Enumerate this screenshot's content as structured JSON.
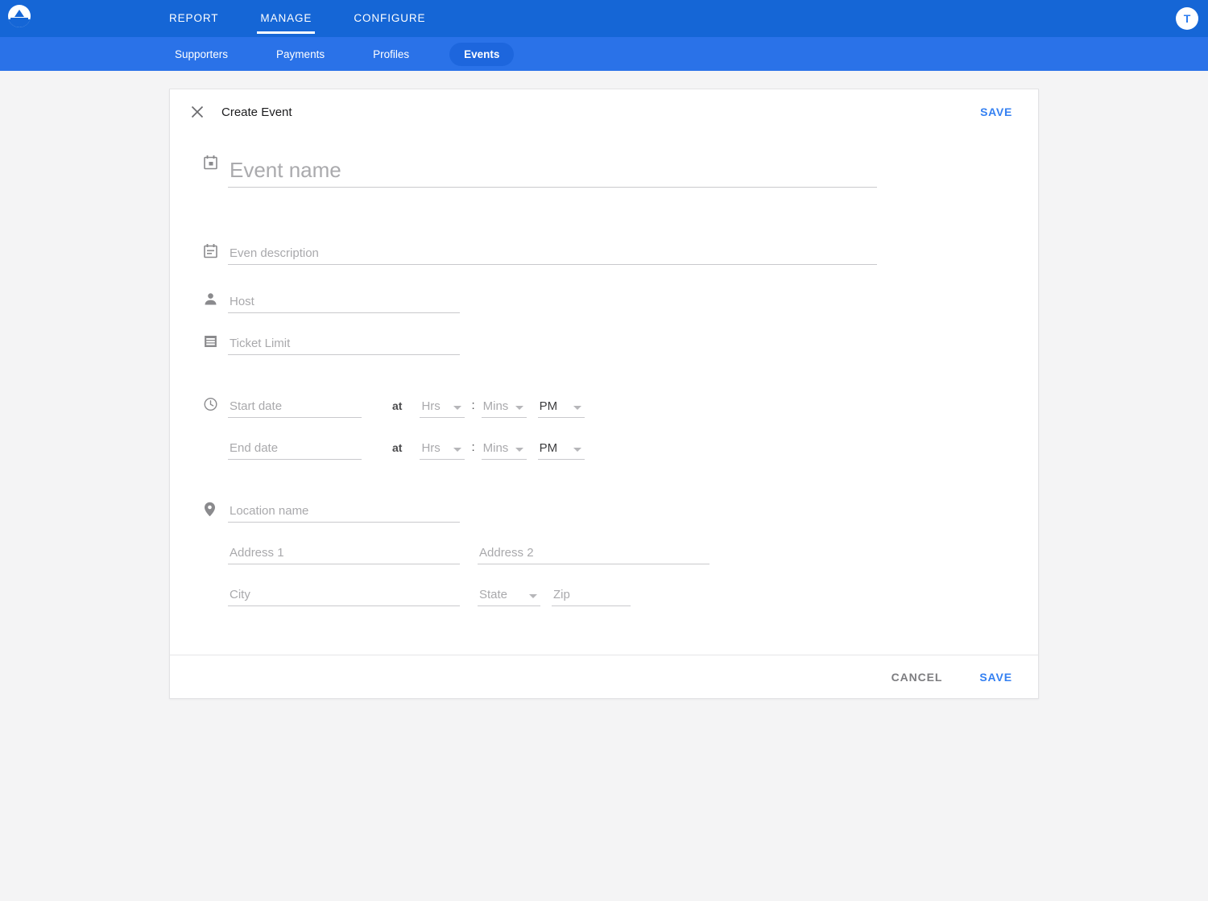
{
  "app": {
    "logo_icon": "lighthouse-logo-icon",
    "accent_blue": "#1566d6",
    "subnav_blue": "#2a72e8",
    "link_blue": "#3480f2"
  },
  "topnav": {
    "tabs": [
      {
        "label": "REPORT",
        "active": false
      },
      {
        "label": "MANAGE",
        "active": true
      },
      {
        "label": "CONFIGURE",
        "active": false
      }
    ],
    "avatar_initial": "T"
  },
  "subnav": {
    "items": [
      {
        "label": "Supporters",
        "active": false
      },
      {
        "label": "Payments",
        "active": false
      },
      {
        "label": "Profiles",
        "active": false
      },
      {
        "label": "Events",
        "active": true
      }
    ]
  },
  "card": {
    "close_icon": "close-icon",
    "title": "Create Event",
    "header_save_label": "SAVE",
    "footer": {
      "cancel_label": "CANCEL",
      "save_label": "SAVE"
    }
  },
  "form": {
    "event_name": {
      "icon": "calendar-today-icon",
      "placeholder": "Event name",
      "value": ""
    },
    "event_description": {
      "icon": "event-note-icon",
      "placeholder": "Even description",
      "value": ""
    },
    "host": {
      "icon": "person-icon",
      "placeholder": "Host",
      "value": ""
    },
    "ticket_limit": {
      "icon": "ticket-icon",
      "placeholder": "Ticket Limit",
      "value": ""
    },
    "schedule_icon": "clock-icon",
    "start": {
      "date_placeholder": "Start date",
      "date_value": "",
      "at_label": "at",
      "hrs_placeholder": "Hrs",
      "hrs_value": "",
      "colon": ":",
      "mins_placeholder": "Mins",
      "mins_value": "",
      "ampm_value": "PM"
    },
    "end": {
      "date_placeholder": "End date",
      "date_value": "",
      "at_label": "at",
      "hrs_placeholder": "Hrs",
      "hrs_value": "",
      "colon": ":",
      "mins_placeholder": "Mins",
      "mins_value": "",
      "ampm_value": "PM"
    },
    "location_icon": "location-pin-icon",
    "location_name": {
      "placeholder": "Location name",
      "value": ""
    },
    "address1": {
      "placeholder": "Address 1",
      "value": ""
    },
    "address2": {
      "placeholder": "Address 2",
      "value": ""
    },
    "city": {
      "placeholder": "City",
      "value": ""
    },
    "state": {
      "placeholder": "State",
      "value": ""
    },
    "zip": {
      "placeholder": "Zip",
      "value": ""
    }
  }
}
